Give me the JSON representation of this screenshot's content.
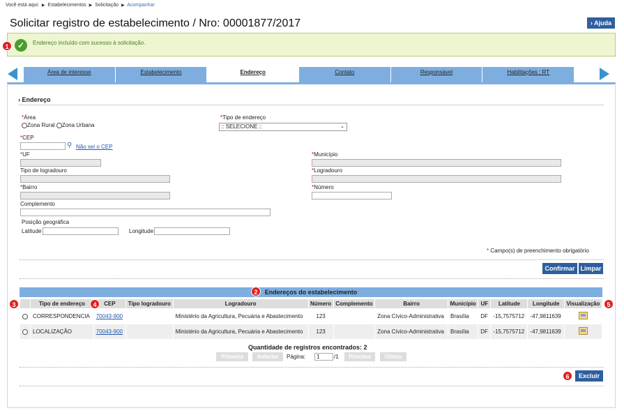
{
  "breadcrumb": {
    "prefix": "Você está aqui:",
    "items": [
      "Estabelecimentos",
      "Solicitação",
      "Acompanhar"
    ]
  },
  "page_title": "Solicitar registro de estabelecimento / Nro: 00001877/2017",
  "help_label": "Ajuda",
  "alert": {
    "message": "Endereço incluído com sucesso à solicitação."
  },
  "badges": [
    "1",
    "2",
    "3",
    "4",
    "5",
    "6"
  ],
  "tabs": [
    {
      "label": "Área de interesse",
      "active": false
    },
    {
      "label": "Estabelecimento",
      "active": false
    },
    {
      "label": "Endereço",
      "active": true
    },
    {
      "label": "Contato",
      "active": false
    },
    {
      "label": "Responsável",
      "active": false
    },
    {
      "label": "Habilitações : RT",
      "active": false
    }
  ],
  "form": {
    "section_title": "Endereço",
    "area_label": "Área",
    "area_options": [
      "Zona Rural",
      "Zona Urbana"
    ],
    "tipo_endereco_label": "Tipo de endereço",
    "tipo_endereco_value": ":: SELECIONE ::",
    "cep_label": "CEP",
    "cep_value": "",
    "cep_link": "Não sei o CEP",
    "uf_label": "UF",
    "municipio_label": "Município",
    "tipo_logradouro_label": "Tipo de logradouro",
    "logradouro_label": "Logradouro",
    "bairro_label": "Bairro",
    "numero_label": "Número",
    "complemento_label": "Complemento",
    "posicao_label": "Posição geográfica",
    "latitude_label": "Latitude",
    "longitude_label": "Longitude",
    "required_note": "Campo(s) de preenchimento obrigatório",
    "confirm_label": "Confirmar",
    "clear_label": "Limpar",
    "required_mark": "*"
  },
  "table": {
    "title": "Endereços do estabelecimento",
    "columns": [
      "Tipo de endereço",
      "CEP",
      "Tipo logradouro",
      "Logradouro",
      "Número",
      "Complemento",
      "Bairro",
      "Município",
      "UF",
      "Latitude",
      "Longitude",
      "Visualização"
    ],
    "rows": [
      {
        "tipo": "CORRESPONDENCIA",
        "cep": "70043-900",
        "tipo_logradouro": "",
        "logradouro": "Ministério da Agricultura, Pecuária e Abastecimento",
        "numero": "123",
        "complemento": "",
        "bairro": "Zona Cívico-Administrativa",
        "municipio": "Brasília",
        "uf": "DF",
        "latitude": "-15,7575712",
        "longitude": "-47,9811639"
      },
      {
        "tipo": "LOCALIZAÇÃO",
        "cep": "70043-900",
        "tipo_logradouro": "",
        "logradouro": "Ministério da Agricultura, Pecuária e Abastecimento",
        "numero": "123",
        "complemento": "",
        "bairro": "Zona Cívico-Administrativa",
        "municipio": "Brasília",
        "uf": "DF",
        "latitude": "-15,7575712",
        "longitude": "-47,9811639"
      }
    ],
    "count_label": "Quantidade de registros encontrados:",
    "count_value": "2",
    "pager": {
      "first": "Primeira",
      "prev": "Anterior",
      "page_label": "Página:",
      "page_value": "1",
      "total": "/1",
      "next": "Próxima",
      "last": "Última"
    },
    "delete_label": "Excluir"
  }
}
